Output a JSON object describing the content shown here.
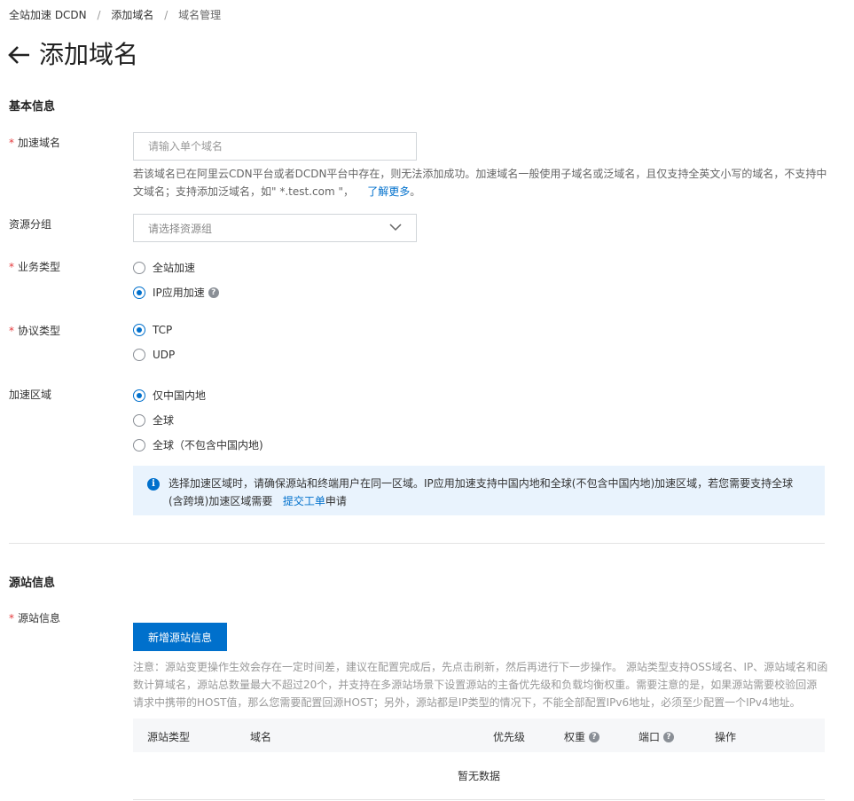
{
  "breadcrumb": {
    "items": [
      "全站加速 DCDN",
      "添加域名"
    ],
    "current": "域名管理"
  },
  "page": {
    "title": "添加域名"
  },
  "basic": {
    "section_title": "基本信息",
    "domain": {
      "label": "加速域名",
      "placeholder": "请输入单个域名",
      "help_line1": "若该域名已在阿里云CDN平台或者DCDN平台中存在，则无法添加成功。加速域名一般使用子域名或泛域名，且仅支持全英文小写的域名，不支持中",
      "help_line2": "文域名；支持添加泛域名，如\" *.test.com \"，",
      "help_link": "了解更多",
      "help_end": "。"
    },
    "resource_group": {
      "label": "资源分组",
      "placeholder": "请选择资源组"
    },
    "business_type": {
      "label": "业务类型",
      "options": [
        "全站加速",
        "IP应用加速"
      ],
      "selected": 1
    },
    "protocol": {
      "label": "协议类型",
      "options": [
        "TCP",
        "UDP"
      ],
      "selected": 0
    },
    "region": {
      "label": "加速区域",
      "options": [
        "仅中国内地",
        "全球",
        "全球（不包含中国内地)"
      ],
      "selected": 0
    },
    "notice": {
      "line1": "选择加速区域时，请确保源站和终端用户在同一区域。IP应用加速支持中国内地和全球(不包含中国内地)加速区域，若您需要支持全球",
      "line2_pre": "(含跨境)加速区域需要",
      "link": "提交工单",
      "line2_post": "申请"
    }
  },
  "origin": {
    "section_title": "源站信息",
    "label": "源站信息",
    "add_button": "新增源站信息",
    "note_line1": "注意：源站变更操作生效会存在一定时间差，建议在配置完成后，先点击刷新，然后再进行下一步操作。 源站类型支持OSS域名、IP、源站域名和函",
    "note_line2": "数计算域名，源站总数量最大不超过20个，并支持在多源站场景下设置源站的主备优先级和负载均衡权重。需要注意的是，如果源站需要校验回源",
    "note_line3": "请求中携带的HOST值，那么您需要配置回源HOST；另外，源站都是IP类型的情况下，不能全部配置IPv6地址，必须至少配置一个IPv4地址。",
    "table": {
      "headers": [
        "源站类型",
        "域名",
        "优先级",
        "权重",
        "端口",
        "操作"
      ],
      "empty": "暂无数据"
    }
  },
  "colors": {
    "primary": "#0070cc",
    "required": "#e4393c",
    "notice_bg": "#e9f3fd"
  },
  "icons": [
    "back-arrow-icon",
    "chevron-down-icon",
    "question-icon",
    "info-icon"
  ]
}
